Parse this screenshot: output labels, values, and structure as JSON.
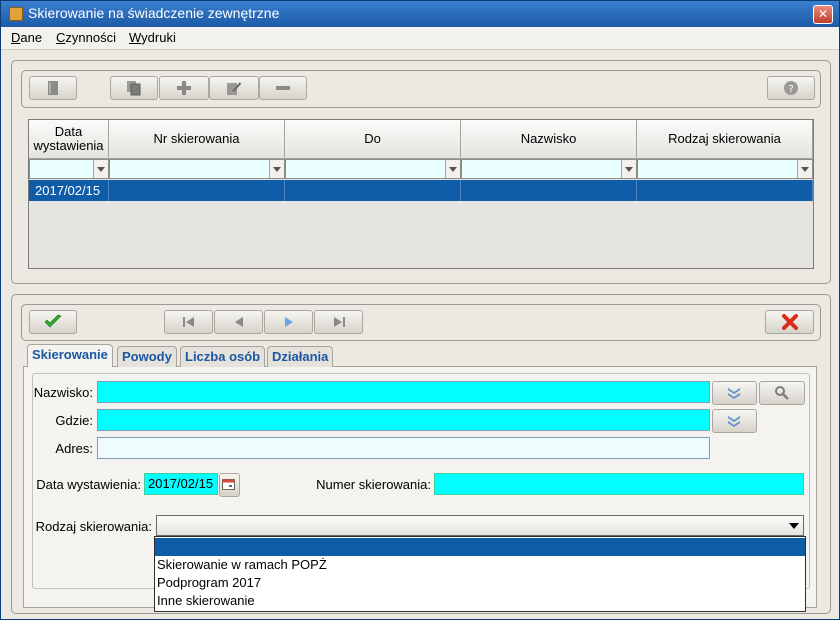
{
  "window": {
    "title": "Skierowanie na świadczenie zewnętrzne",
    "close_label": "✕"
  },
  "menu": [
    {
      "label": "Dane",
      "mnemonic": "D",
      "rest": "ane"
    },
    {
      "label": "Czynności",
      "mnemonic": "C",
      "rest": "zynności"
    },
    {
      "label": "Wydruki",
      "mnemonic": "W",
      "rest": "ydruki"
    }
  ],
  "grid": {
    "columns": [
      "Data wystawienia",
      "Nr skierowania",
      "Do",
      "Nazwisko",
      "Rodzaj skierowania"
    ],
    "rows": [
      {
        "data": "2017/02/15",
        "nr": "",
        "do": "",
        "nazwisko": "",
        "rodzaj": ""
      }
    ]
  },
  "tabs": [
    {
      "label": "Skierowanie",
      "active": true
    },
    {
      "label": "Powody",
      "active": false
    },
    {
      "label": "Liczba osób",
      "active": false
    },
    {
      "label": "Działania",
      "active": false
    }
  ],
  "form": {
    "nazwisko_label": "Nazwisko:",
    "nazwisko_value": "",
    "gdzie_label": "Gdzie:",
    "gdzie_value": "",
    "adres_label": "Adres:",
    "adres_value": "",
    "data_label": "Data wystawienia:",
    "data_value": "2017/02/15",
    "numer_label": "Numer skierowania:",
    "numer_value": "",
    "rodzaj_label": "Rodzaj skierowania:",
    "rodzaj_value": ""
  },
  "dropdown": {
    "options": [
      "",
      "Skierowanie w ramach POPŻ",
      "Podprogram 2017",
      "Inne skierowanie"
    ],
    "selected_index": 0
  },
  "colors": {
    "selection": "#0f5ca8",
    "required_field": "#00ffff",
    "tab_text": "#1b57a3",
    "confirm": "#2eaa2e",
    "cancel": "#d92a1a"
  }
}
